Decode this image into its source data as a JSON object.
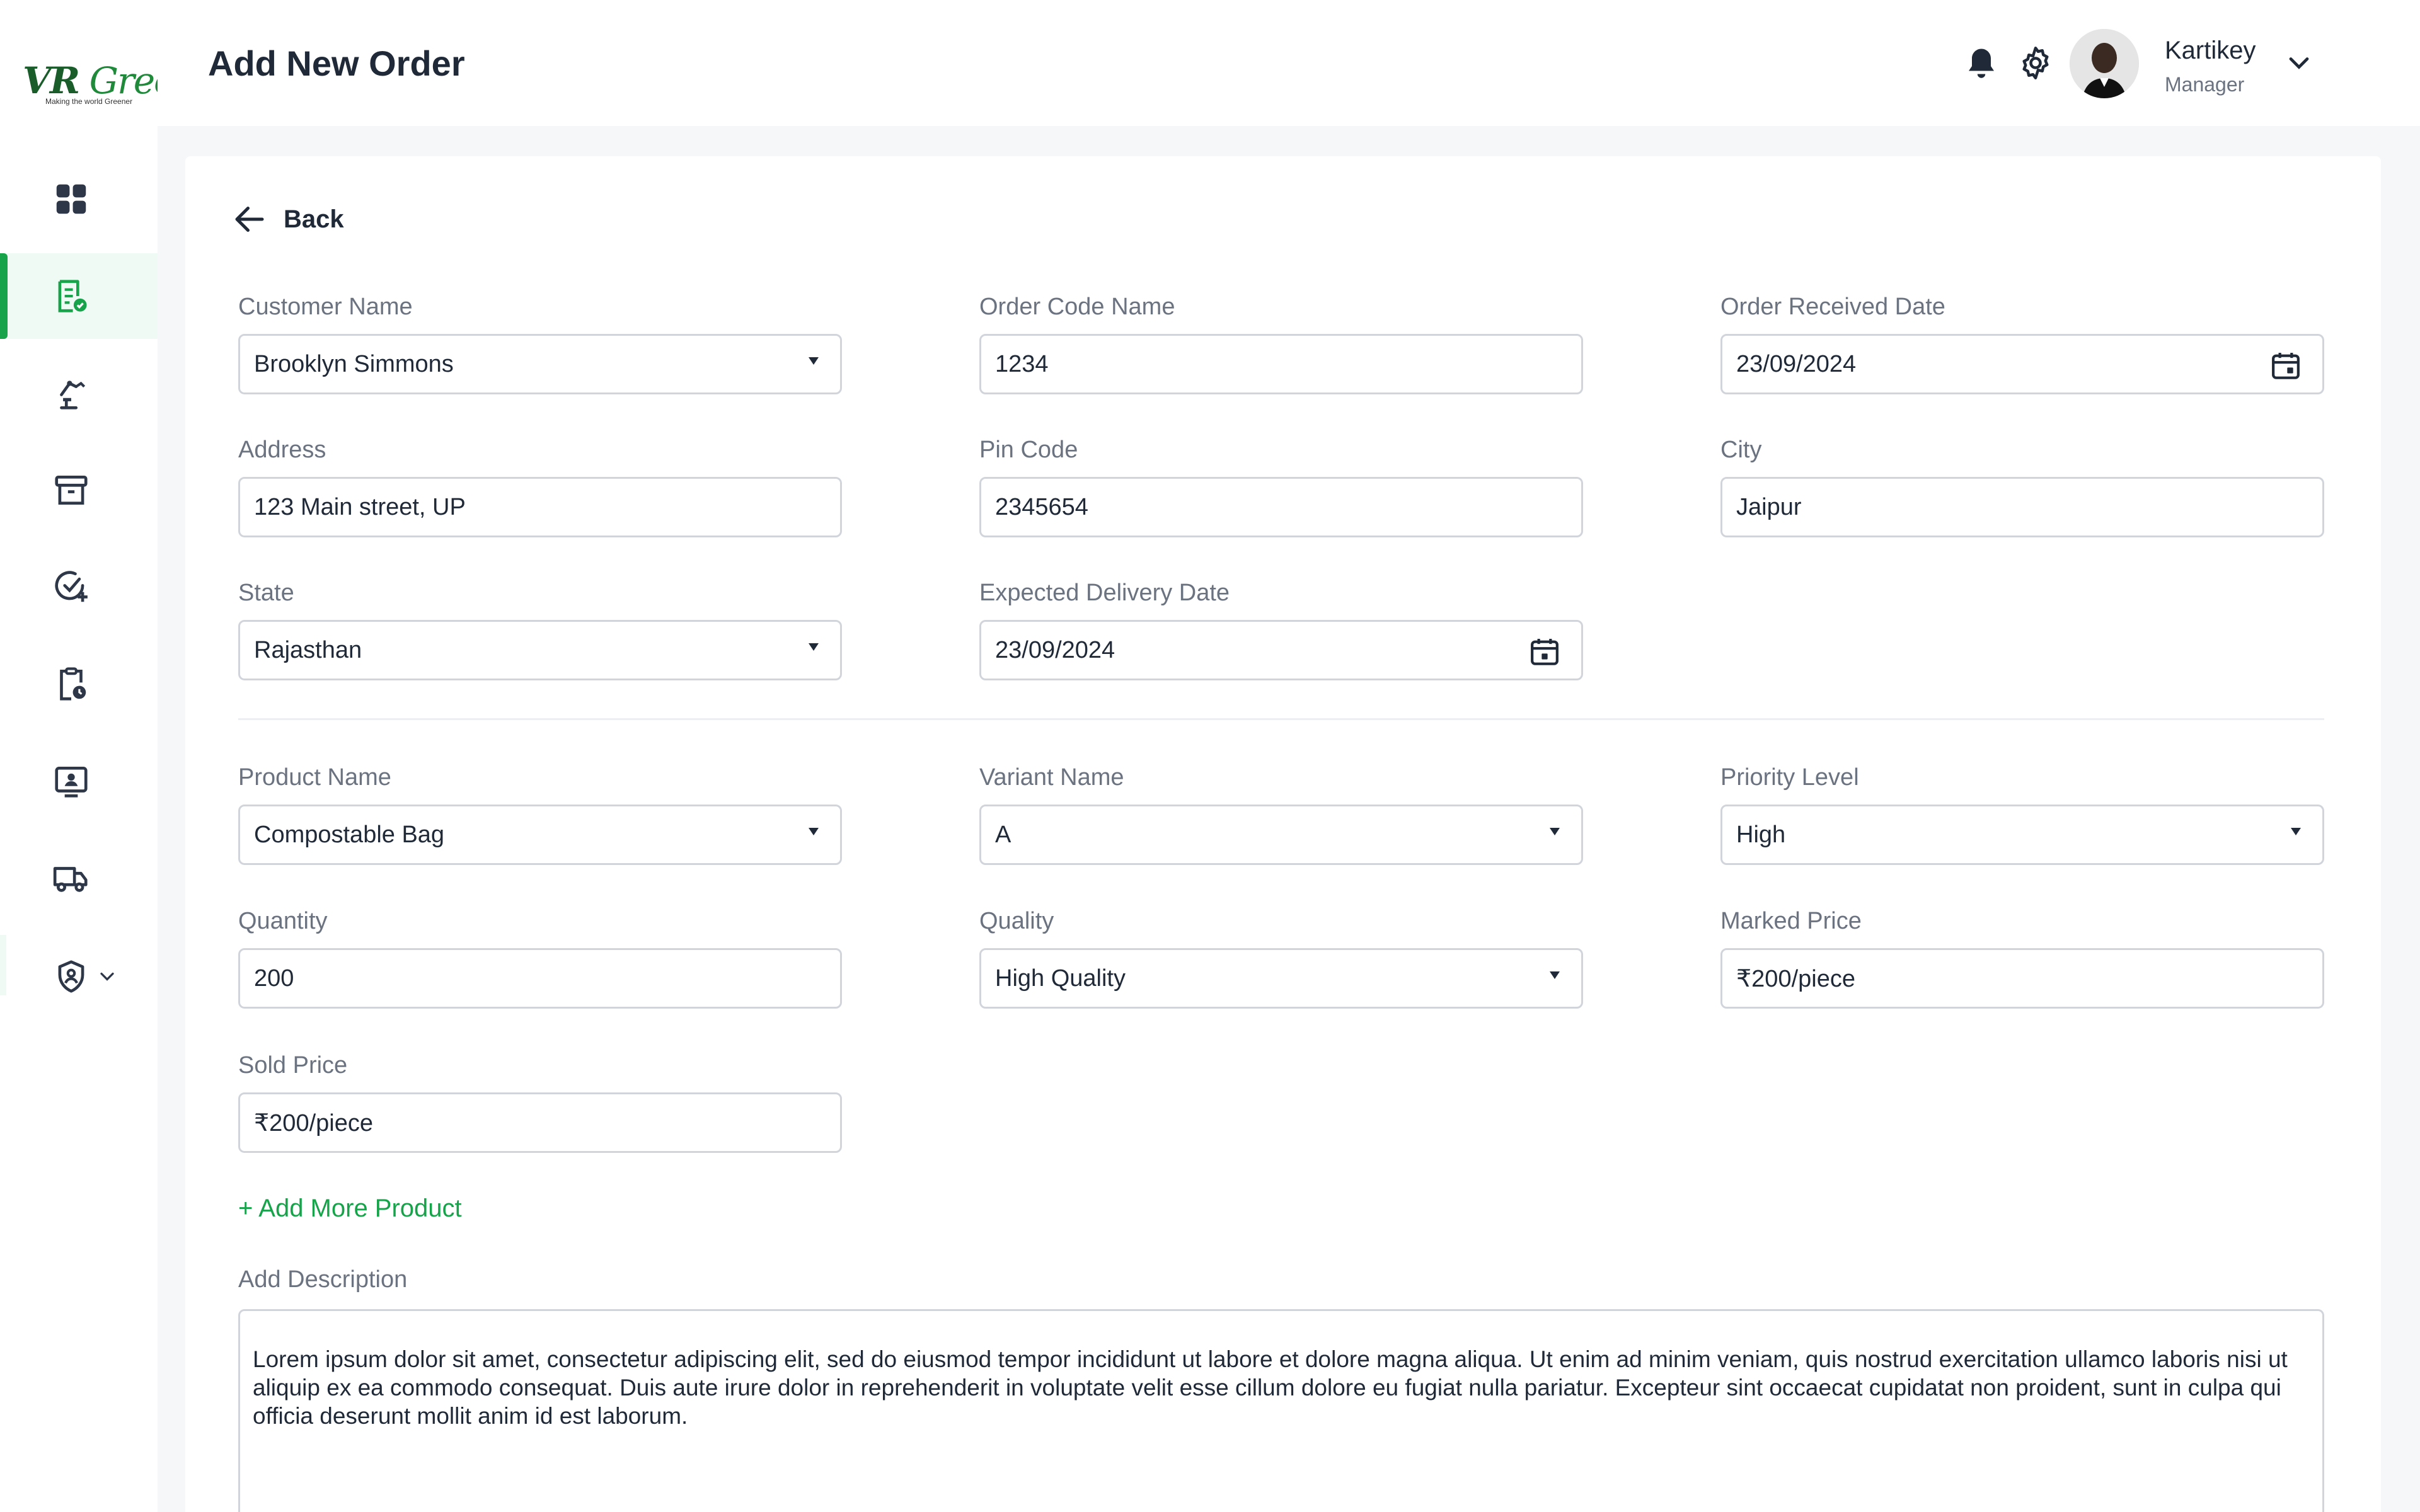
{
  "brand": {
    "logo_text": "VR Green",
    "tagline": "Making the world Greener",
    "accent_color": "#16a34a"
  },
  "sidebar": {
    "items": [
      {
        "icon": "dashboard-grid-icon"
      },
      {
        "icon": "orders-document-check-icon",
        "active": true
      },
      {
        "icon": "production-machine-icon"
      },
      {
        "icon": "archive-box-icon"
      },
      {
        "icon": "check-add-icon"
      },
      {
        "icon": "clipboard-clock-icon"
      },
      {
        "icon": "user-badge-screen-icon"
      },
      {
        "icon": "delivery-truck-icon"
      },
      {
        "icon": "shield-user-icon",
        "has_dropdown": true
      }
    ]
  },
  "header": {
    "title": "Add New Order",
    "icons": [
      "bell-icon",
      "gear-icon"
    ],
    "user": {
      "name": "Kartikey",
      "role": "Manager"
    }
  },
  "form": {
    "back_label": "Back",
    "customer_name": {
      "label": "Customer Name",
      "value": "Brooklyn Simmons"
    },
    "order_code_name": {
      "label": "Order Code Name",
      "value": "1234"
    },
    "order_received_date": {
      "label": "Order Received Date",
      "value": "23/09/2024"
    },
    "address": {
      "label": "Address",
      "value": "123 Main street, UP"
    },
    "pin_code": {
      "label": "Pin Code",
      "value": "2345654"
    },
    "city": {
      "label": "City",
      "value": "Jaipur"
    },
    "state": {
      "label": "State",
      "value": "Rajasthan"
    },
    "expected_delivery_date": {
      "label": "Expected Delivery Date",
      "value": "23/09/2024"
    },
    "product_name": {
      "label": "Product Name",
      "value": "Compostable Bag"
    },
    "variant_name": {
      "label": "Variant Name",
      "value": "A"
    },
    "priority_level": {
      "label": "Priority Level",
      "value": "High"
    },
    "quantity": {
      "label": "Quantity",
      "value": "200"
    },
    "quality": {
      "label": "Quality",
      "value": "High Quality"
    },
    "marked_price": {
      "label": "Marked Price",
      "value": "₹200/piece"
    },
    "sold_price": {
      "label": "Sold Price",
      "value": "₹200/piece"
    },
    "add_more_label": "+ Add More Product",
    "description": {
      "label": "Add Description",
      "value": "Lorem ipsum dolor sit amet, consectetur adipiscing elit, sed do eiusmod tempor incididunt ut labore et dolore magna aliqua. Ut enim ad minim veniam, quis nostrud exercitation ullamco laboris nisi ut aliquip ex ea commodo consequat. Duis aute irure dolor in reprehenderit in voluptate velit esse cillum dolore eu fugiat nulla pariatur. Excepteur sint occaecat cupidatat non proident, sunt in culpa qui officia deserunt mollit anim id est laborum."
    }
  }
}
